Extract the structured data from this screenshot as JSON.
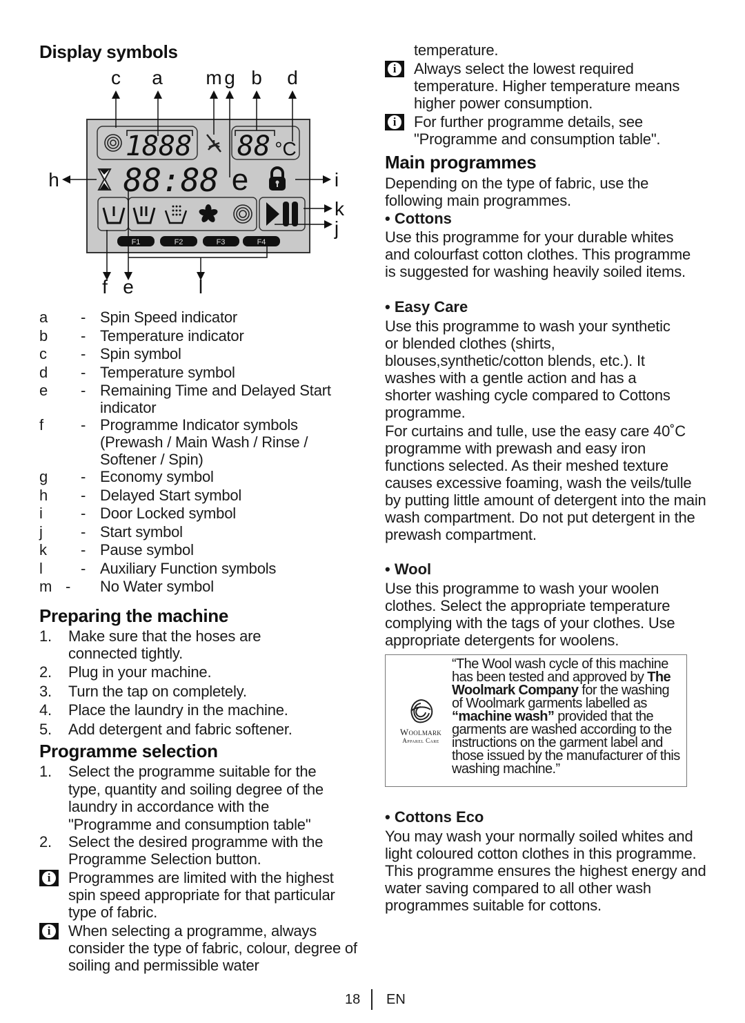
{
  "left": {
    "display_title": "Display symbols",
    "diagram": {
      "callouts": {
        "c": "c",
        "a": "a",
        "m": "m",
        "g": "g",
        "b": "b",
        "d": "d",
        "h": "h",
        "i": "i",
        "k": "k",
        "j": "j",
        "f": "f",
        "e": "e",
        "l": "l"
      },
      "spin_digits": "1888",
      "temp_digits": "88",
      "temp_unit": "°C",
      "time_digits": "88:88",
      "eco_glyph": "e",
      "aux_buttons": [
        "F1",
        "F2",
        "F3",
        "F4"
      ],
      "lcd_color": "#c8c8c8"
    },
    "legend": [
      {
        "key": "a",
        "text": "Spin Speed indicator"
      },
      {
        "key": "b",
        "text": "Temperature indicator"
      },
      {
        "key": "c",
        "text": "Spin symbol"
      },
      {
        "key": "d",
        "text": "Temperature symbol"
      },
      {
        "key": "e",
        "text": "Remaining Time and Delayed Start indicator"
      },
      {
        "key": "f",
        "text": "Programme Indicator symbols (Prewash / Main Wash / Rinse / Softener / Spin)"
      },
      {
        "key": "g",
        "text": "Economy symbol"
      },
      {
        "key": "h",
        "text": "Delayed Start symbol"
      },
      {
        "key": "i",
        "text": "Door Locked symbol"
      },
      {
        "key": "j",
        "text": "Start symbol"
      },
      {
        "key": "k",
        "text": "Pause symbol"
      },
      {
        "key": "l",
        "text": "Auxiliary Function symbols"
      },
      {
        "key": "m",
        "text": "No Water symbol"
      }
    ],
    "legend_dash": "-",
    "preparing": {
      "title": "Preparing the machine",
      "steps": [
        {
          "n": "1.",
          "text": "Make sure that the hoses are connected tightly."
        },
        {
          "n": "2.",
          "text": "Plug in your machine."
        },
        {
          "n": "3.",
          "text": "Turn the tap on completely."
        },
        {
          "n": "4.",
          "text": "Place the laundry in the machine."
        },
        {
          "n": "5.",
          "text": "Add detergent and fabric softener."
        }
      ]
    },
    "selection": {
      "title": "Programme selection",
      "steps": [
        {
          "n": "1.",
          "text": "Select the programme suitable for the type, quantity and soiling degree of the laundry in accordance with the \"Programme and consumption table\""
        },
        {
          "n": "2.",
          "text": "Select the desired programme with the Programme Selection button."
        }
      ],
      "notes": [
        "Programmes are limited with the highest spin speed appropriate for that particular type of fabric.",
        "When selecting a programme, always consider the type of fabric, colour, degree of soiling and permissible water"
      ]
    }
  },
  "right": {
    "continued": "temperature.",
    "notes": [
      "Always select the lowest required temperature. Higher temperature means higher power consumption.",
      "For further programme details, see \"Programme and consumption table\"."
    ],
    "main_title": "Main programmes",
    "intro": "Depending on the type of fabric, use the following main programmes.",
    "programmes": [
      {
        "name": "• Cottons",
        "text": "Use this programme for your durable whites and colourfast cotton clothes. This programme is suggested for washing heavily soiled items."
      },
      {
        "name": "• Easy Care",
        "text": "Use this programme to wash your synthetic or blended clothes (shirts, blouses,synthetic/cotton blends, etc.). It washes with a gentle action and has a shorter washing cycle compared to Cottons programme.",
        "text2": "For curtains and tulle, use the  easy care 40˚C programme with prewash and easy iron functions selected. As their meshed texture causes excessive foaming, wash the veils/tulle by putting little amount of detergent into the main wash compartment. Do not put detergent in the prewash compartment."
      },
      {
        "name": "• Wool",
        "text": "Use this programme to wash your woolen clothes. Select the appropriate temperature complying with the tags of your clothes. Use appropriate detergents for woolens."
      }
    ],
    "woolmark": {
      "logo_line1": "Woolmark",
      "logo_line2": "Apparel Care",
      "q1": "“The Wool wash cycle of this machine has been tested and approved by ",
      "company": "The Woolmark Company",
      "q2": " for the washing of Woolmark garments labelled as ",
      "machine_wash": "“machine wash”",
      "q3": " provided that the garments are washed according to the instructions on the garment label and those issued by the manufacturer of this washing machine.”"
    },
    "eco": {
      "name": "• Cottons Eco",
      "text": "You may wash your normally soiled whites and light coloured cotton clothes in this programme. This programme ensures the highest energy and water saving compared to all other wash programmes suitable for cottons."
    }
  },
  "footer": {
    "page": "18",
    "lang": "EN"
  }
}
